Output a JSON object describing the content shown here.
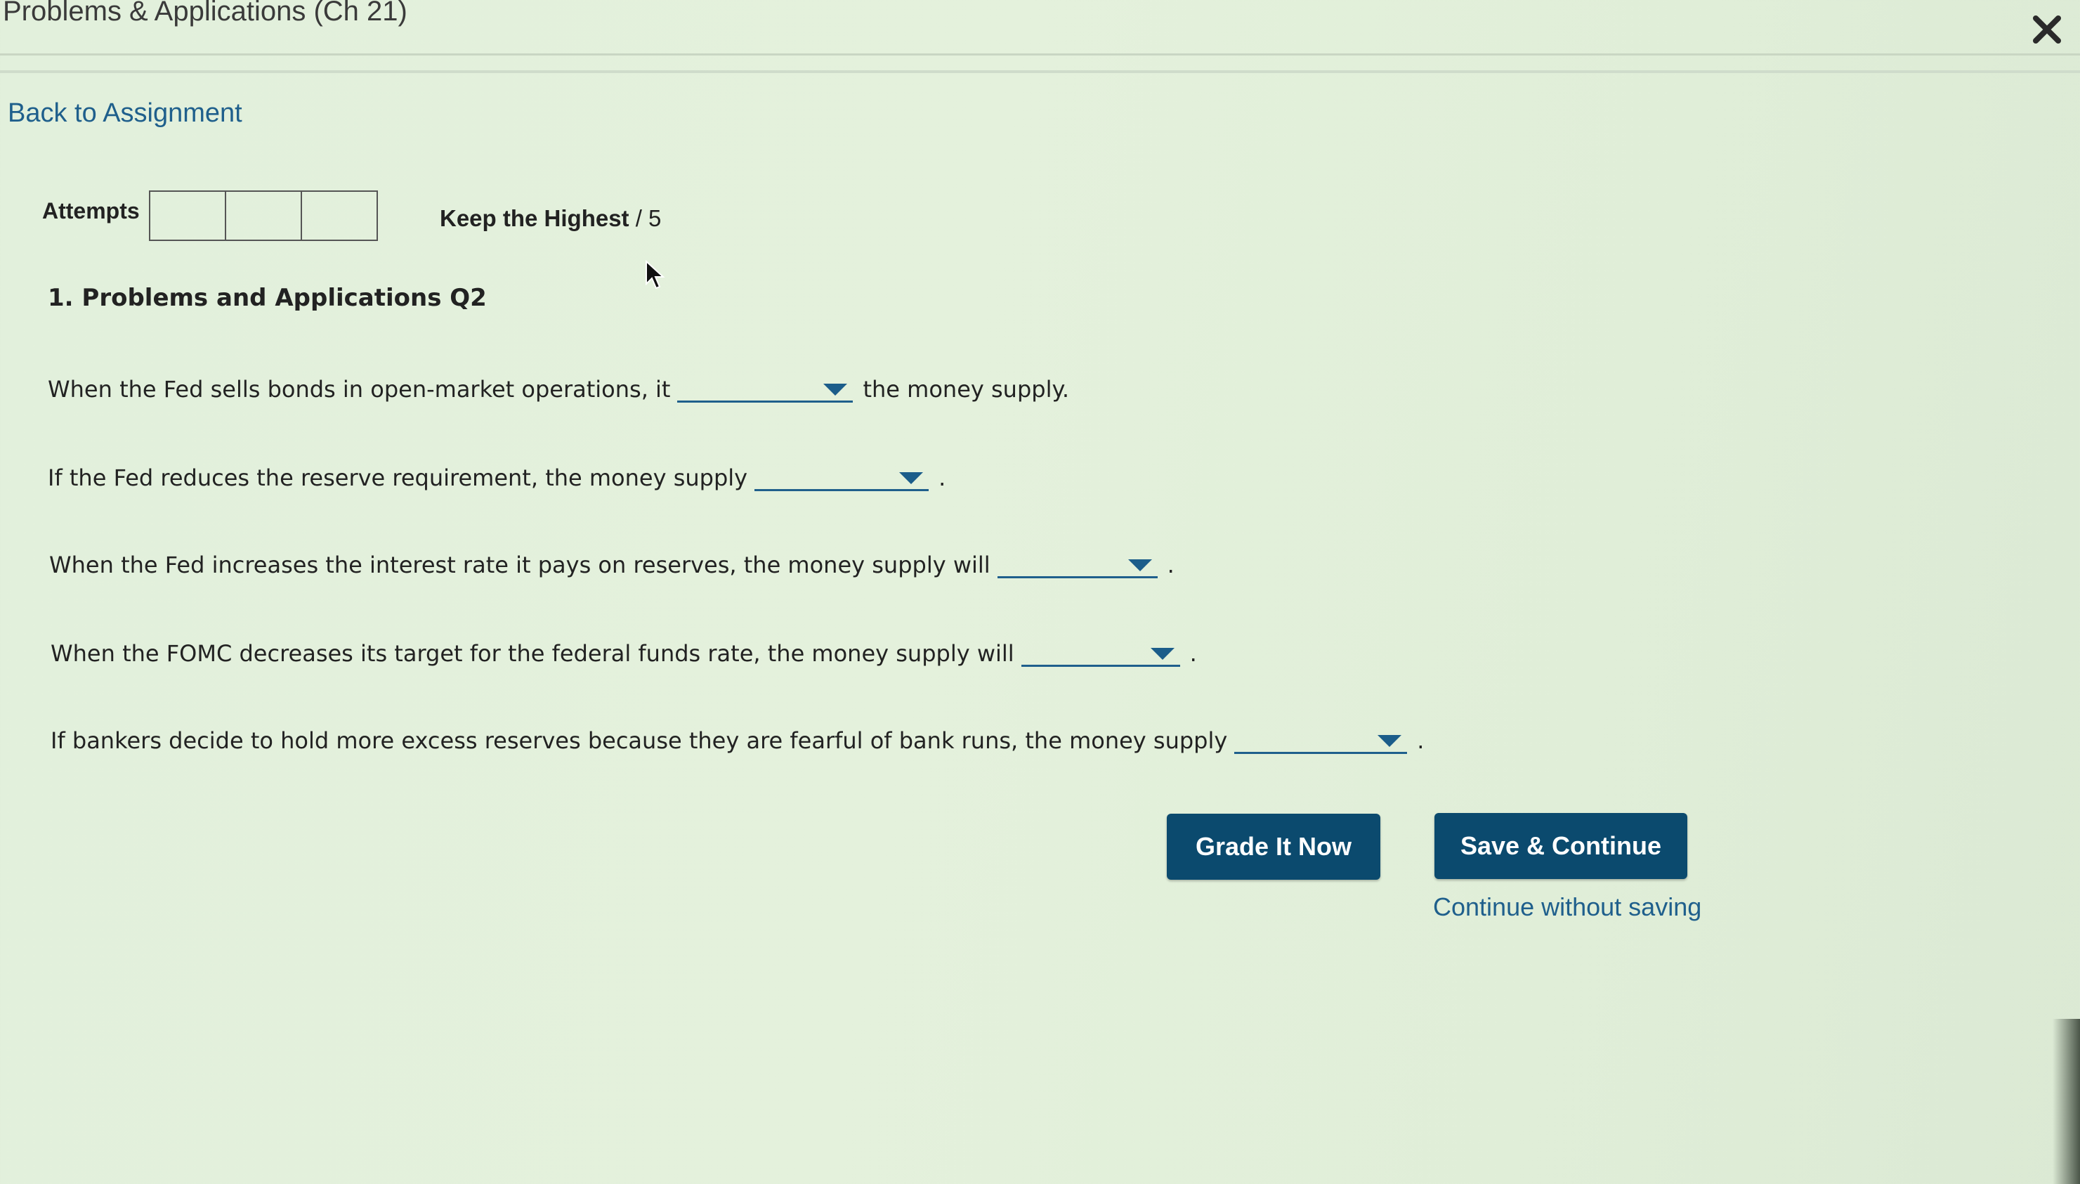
{
  "window": {
    "title": "Problems & Applications (Ch 21)",
    "close_icon": "close-icon"
  },
  "nav": {
    "back_label": "Back to Assignment"
  },
  "attempts": {
    "label": "Attempts",
    "boxes": [
      "",
      "",
      ""
    ],
    "policy_label": "Keep the Highest",
    "policy_suffix": "/ 5"
  },
  "question": {
    "title": "1. Problems and Applications Q2",
    "items": [
      {
        "before": "When the Fed sells bonds in open-market operations, it",
        "selected": "",
        "after": "the money supply."
      },
      {
        "before": "If the Fed reduces the reserve requirement, the money supply",
        "selected": "",
        "after": "."
      },
      {
        "before": "When the Fed increases the interest rate it pays on reserves, the money supply will",
        "selected": "",
        "after": "."
      },
      {
        "before": "When the FOMC decreases its target for the federal funds rate, the money supply will",
        "selected": "",
        "after": "."
      },
      {
        "before": "If bankers decide to hold more excess reserves because they are fearful of bank runs, the money supply",
        "selected": "",
        "after": "."
      }
    ]
  },
  "actions": {
    "grade_label": "Grade It Now",
    "save_label": "Save & Continue",
    "continue_label": "Continue without saving"
  },
  "colors": {
    "accent": "#0b4a6e",
    "link": "#1f5f8c",
    "background": "#e2f0dc"
  }
}
